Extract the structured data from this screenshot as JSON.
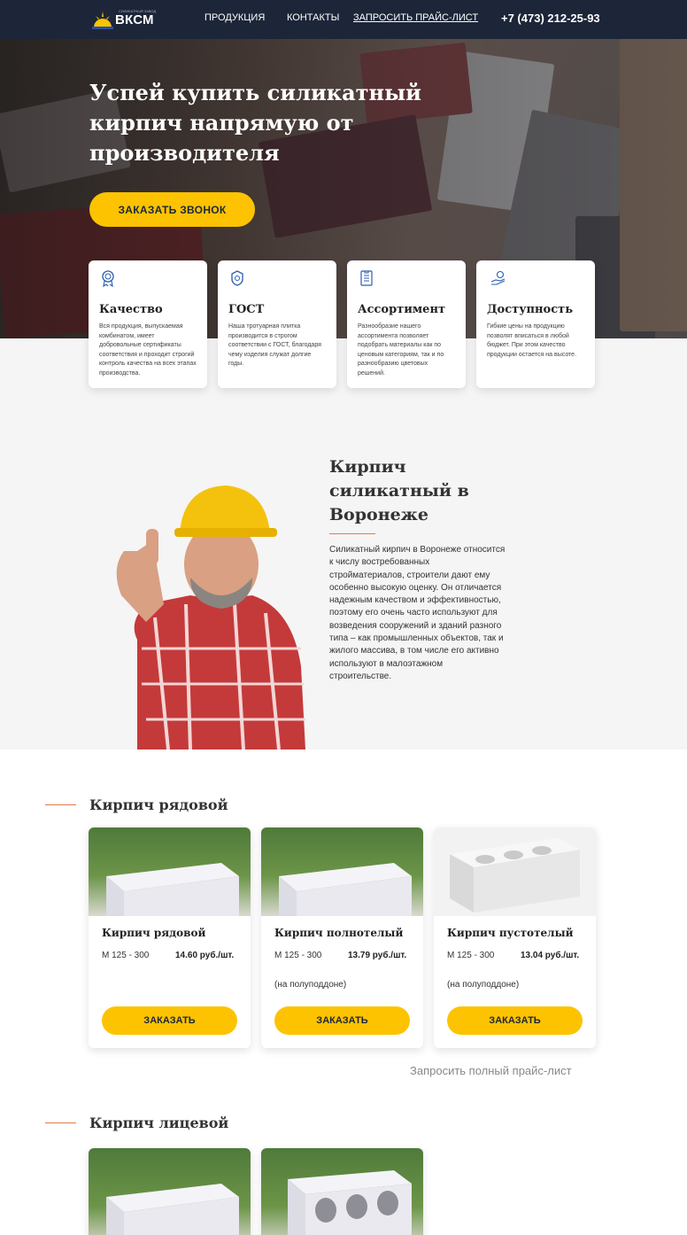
{
  "nav": {
    "logo_text": "ВКСМ",
    "logo_tag": "СИЛИКАТНЫЙ ЗАВОД",
    "links": [
      "ПРОДУКЦИЯ",
      "КОНТАКТЫ",
      "ЗАПРОСИТЬ ПРАЙС-ЛИСТ"
    ],
    "phone": "+7 (473) 212-25-93"
  },
  "hero": {
    "title": "Успей купить силикатный кирпич напрямую от производителя",
    "cta": "ЗАКАЗАТЬ ЗВОНОК"
  },
  "features": [
    {
      "icon": "award-icon",
      "title": "Качество",
      "text": "Вся продукция, выпускаемая комбинатом, имеет добровольные сертификаты соответствия и проходит строгий контроль качества на всех этапах производства."
    },
    {
      "icon": "badge-icon",
      "title": "ГОСТ",
      "text": "Наша тротуарная плитка производится в строгом соответствии с ГОСТ, благодаря чему изделия служат долгие годы."
    },
    {
      "icon": "checklist-icon",
      "title": "Ассортимент",
      "text": "Разнообразие нашего ассортимента позволяет подобрать материалы как по ценовым категориям, так и по разнообразию цветовых решений."
    },
    {
      "icon": "hand-coin-icon",
      "title": "Доступность",
      "text": "Гибкие цены на продукцию позволят вписаться в любой бюджет. При этом качество продукции остается на высоте."
    }
  ],
  "about": {
    "title": "Кирпич силикатный в Воронеже",
    "text": "Силикатный кирпич в Воронеже относится к числу востребованных стройматериалов, строители дают ему особенно высокую оценку. Он отличается надежным качеством и эффективностью, поэтому его очень часто используют для возведения сооружений и зданий разного типа – как промышленных объектов, так и жилого массива, в том числе его активно используют в малоэтажном строительстве."
  },
  "section1": {
    "title": "Кирпич рядовой",
    "products": [
      {
        "name": "Кирпич рядовой",
        "mark": "М 125 - 300",
        "price": "14.60 руб./шт.",
        "note": "",
        "button": "ЗАКАЗАТЬ"
      },
      {
        "name": "Кирпич полнотелый",
        "mark": "М 125 - 300",
        "price": "13.79 руб./шт.",
        "note": "(на полуподдоне)",
        "button": "ЗАКАЗАТЬ"
      },
      {
        "name": "Кирпич пустотелый",
        "mark": "М 125 - 300",
        "price": "13.04 руб./шт.",
        "note": "(на полуподдоне)",
        "button": "ЗАКАЗАТЬ"
      }
    ],
    "price_link": "Запросить полный прайс-лист"
  },
  "section2": {
    "title": "Кирпич лицевой"
  },
  "colors": {
    "nav_bg": "#1c2638",
    "accent": "#fdc300",
    "line": "#e07a4a"
  }
}
